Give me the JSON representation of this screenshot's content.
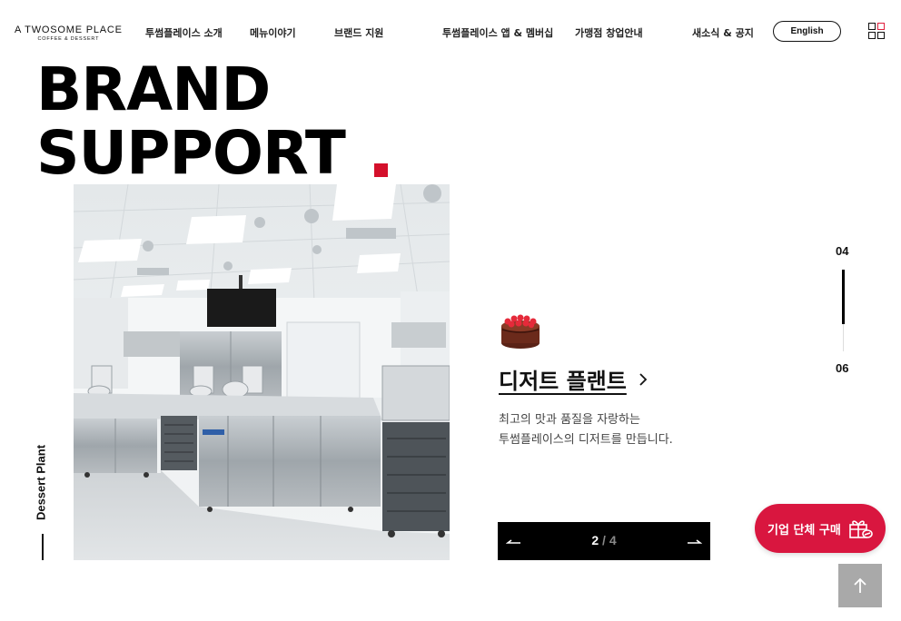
{
  "header": {
    "logo_line1": "A TWOSOME PLACE",
    "logo_line2": "COFFEE & DESSERT",
    "nav": [
      "투썸플레이스 소개",
      "메뉴이야기",
      "브랜드 지원",
      "투썸플레이스 앱 & 멤버십",
      "가맹점 창업안내",
      "새소식 & 공지"
    ],
    "lang_button": "English",
    "menu_icon": "grid-menu-icon"
  },
  "hero": {
    "title_line1": "BRAND",
    "title_line2": "SUPPORT",
    "accent_color": "#d4102b"
  },
  "section": {
    "vertical_label": "Dessert Plant",
    "icon": "cake-icon",
    "title": "디저트 플랜트",
    "description_line1": "최고의 맛과 품질을 자랑하는",
    "description_line2": "투썸플레이스의 디저트를 만듭니다."
  },
  "slider": {
    "current": "2",
    "separator": "/",
    "total": "4",
    "prev_icon": "arrow-left-icon",
    "next_icon": "arrow-right-icon"
  },
  "progress": {
    "top_label": "04",
    "bottom_label": "06",
    "fill_fraction": 0.67
  },
  "corporate_button": {
    "label": "기업 단체 구매",
    "icon": "gift-icon",
    "color": "#d9163f"
  },
  "scroll_top": {
    "icon": "arrow-up-icon",
    "color": "#a9a9a9"
  }
}
